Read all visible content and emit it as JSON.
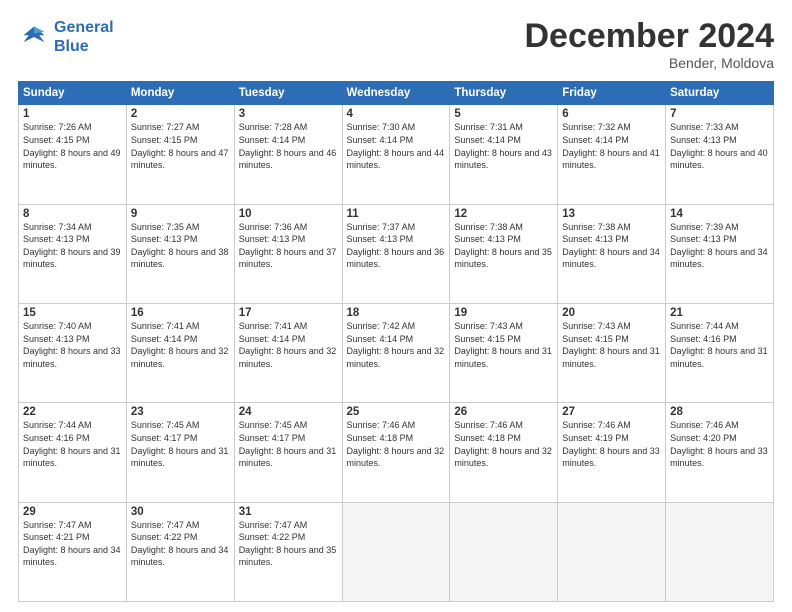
{
  "logo": {
    "line1": "General",
    "line2": "Blue"
  },
  "title": "December 2024",
  "subtitle": "Bender, Moldova",
  "weekdays": [
    "Sunday",
    "Monday",
    "Tuesday",
    "Wednesday",
    "Thursday",
    "Friday",
    "Saturday"
  ],
  "weeks": [
    [
      {
        "day": "1",
        "rise": "7:26 AM",
        "set": "4:15 PM",
        "daylight": "8 hours and 49 minutes."
      },
      {
        "day": "2",
        "rise": "7:27 AM",
        "set": "4:15 PM",
        "daylight": "8 hours and 47 minutes."
      },
      {
        "day": "3",
        "rise": "7:28 AM",
        "set": "4:14 PM",
        "daylight": "8 hours and 46 minutes."
      },
      {
        "day": "4",
        "rise": "7:30 AM",
        "set": "4:14 PM",
        "daylight": "8 hours and 44 minutes."
      },
      {
        "day": "5",
        "rise": "7:31 AM",
        "set": "4:14 PM",
        "daylight": "8 hours and 43 minutes."
      },
      {
        "day": "6",
        "rise": "7:32 AM",
        "set": "4:14 PM",
        "daylight": "8 hours and 41 minutes."
      },
      {
        "day": "7",
        "rise": "7:33 AM",
        "set": "4:13 PM",
        "daylight": "8 hours and 40 minutes."
      }
    ],
    [
      {
        "day": "8",
        "rise": "7:34 AM",
        "set": "4:13 PM",
        "daylight": "8 hours and 39 minutes."
      },
      {
        "day": "9",
        "rise": "7:35 AM",
        "set": "4:13 PM",
        "daylight": "8 hours and 38 minutes."
      },
      {
        "day": "10",
        "rise": "7:36 AM",
        "set": "4:13 PM",
        "daylight": "8 hours and 37 minutes."
      },
      {
        "day": "11",
        "rise": "7:37 AM",
        "set": "4:13 PM",
        "daylight": "8 hours and 36 minutes."
      },
      {
        "day": "12",
        "rise": "7:38 AM",
        "set": "4:13 PM",
        "daylight": "8 hours and 35 minutes."
      },
      {
        "day": "13",
        "rise": "7:38 AM",
        "set": "4:13 PM",
        "daylight": "8 hours and 34 minutes."
      },
      {
        "day": "14",
        "rise": "7:39 AM",
        "set": "4:13 PM",
        "daylight": "8 hours and 34 minutes."
      }
    ],
    [
      {
        "day": "15",
        "rise": "7:40 AM",
        "set": "4:13 PM",
        "daylight": "8 hours and 33 minutes."
      },
      {
        "day": "16",
        "rise": "7:41 AM",
        "set": "4:14 PM",
        "daylight": "8 hours and 32 minutes."
      },
      {
        "day": "17",
        "rise": "7:41 AM",
        "set": "4:14 PM",
        "daylight": "8 hours and 32 minutes."
      },
      {
        "day": "18",
        "rise": "7:42 AM",
        "set": "4:14 PM",
        "daylight": "8 hours and 32 minutes."
      },
      {
        "day": "19",
        "rise": "7:43 AM",
        "set": "4:15 PM",
        "daylight": "8 hours and 31 minutes."
      },
      {
        "day": "20",
        "rise": "7:43 AM",
        "set": "4:15 PM",
        "daylight": "8 hours and 31 minutes."
      },
      {
        "day": "21",
        "rise": "7:44 AM",
        "set": "4:16 PM",
        "daylight": "8 hours and 31 minutes."
      }
    ],
    [
      {
        "day": "22",
        "rise": "7:44 AM",
        "set": "4:16 PM",
        "daylight": "8 hours and 31 minutes."
      },
      {
        "day": "23",
        "rise": "7:45 AM",
        "set": "4:17 PM",
        "daylight": "8 hours and 31 minutes."
      },
      {
        "day": "24",
        "rise": "7:45 AM",
        "set": "4:17 PM",
        "daylight": "8 hours and 31 minutes."
      },
      {
        "day": "25",
        "rise": "7:46 AM",
        "set": "4:18 PM",
        "daylight": "8 hours and 32 minutes."
      },
      {
        "day": "26",
        "rise": "7:46 AM",
        "set": "4:18 PM",
        "daylight": "8 hours and 32 minutes."
      },
      {
        "day": "27",
        "rise": "7:46 AM",
        "set": "4:19 PM",
        "daylight": "8 hours and 33 minutes."
      },
      {
        "day": "28",
        "rise": "7:46 AM",
        "set": "4:20 PM",
        "daylight": "8 hours and 33 minutes."
      }
    ],
    [
      {
        "day": "29",
        "rise": "7:47 AM",
        "set": "4:21 PM",
        "daylight": "8 hours and 34 minutes."
      },
      {
        "day": "30",
        "rise": "7:47 AM",
        "set": "4:22 PM",
        "daylight": "8 hours and 34 minutes."
      },
      {
        "day": "31",
        "rise": "7:47 AM",
        "set": "4:22 PM",
        "daylight": "8 hours and 35 minutes."
      },
      null,
      null,
      null,
      null
    ]
  ]
}
